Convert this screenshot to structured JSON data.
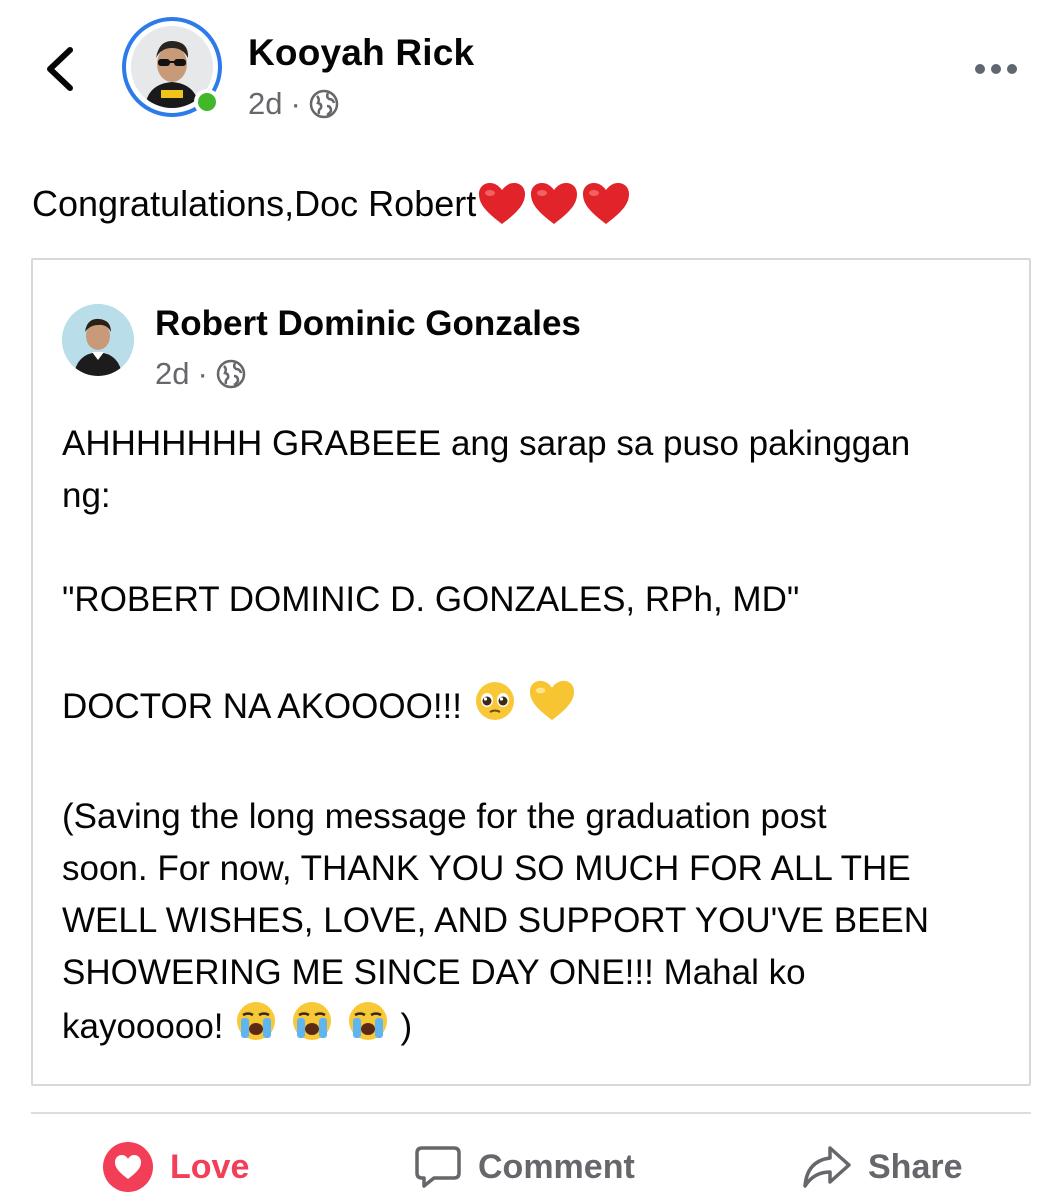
{
  "post": {
    "author": "Kooyah Rick",
    "time": "2d",
    "separator": "·",
    "text": "Congratulations,Doc Robert",
    "shared": {
      "author": "Robert Dominic Gonzales",
      "time": "2d",
      "separator": "·",
      "line1": "AHHHHHHH GRABEEE ang sarap sa puso pakinggan",
      "line2": "ng:",
      "line3": "\"ROBERT DOMINIC D. GONZALES, RPh, MD\"",
      "line4": "DOCTOR NA AKOOOO!!!",
      "line5": "(Saving the long message for the graduation post",
      "line6": "soon. For now, THANK YOU SO MUCH FOR ALL THE",
      "line7": "WELL WISHES, LOVE, AND SUPPORT YOU'VE BEEN",
      "line8": "SHOWERING ME SINCE DAY ONE!!! Mahal ko",
      "line9": "kayooooo!",
      "line9_end": ")"
    }
  },
  "actions": {
    "love": "Love",
    "comment": "Comment",
    "share": "Share"
  },
  "icons": {
    "back": "chevron-left-icon",
    "more": "more-horizontal-icon",
    "privacy": "globe-icon",
    "reaction": "heart-icon",
    "comment": "speech-bubble-icon",
    "share": "share-arrow-icon"
  },
  "colors": {
    "love": "#f33e58",
    "online": "#42b72a",
    "story_ring": "#2d7bea",
    "secondary_text": "#65676b"
  }
}
